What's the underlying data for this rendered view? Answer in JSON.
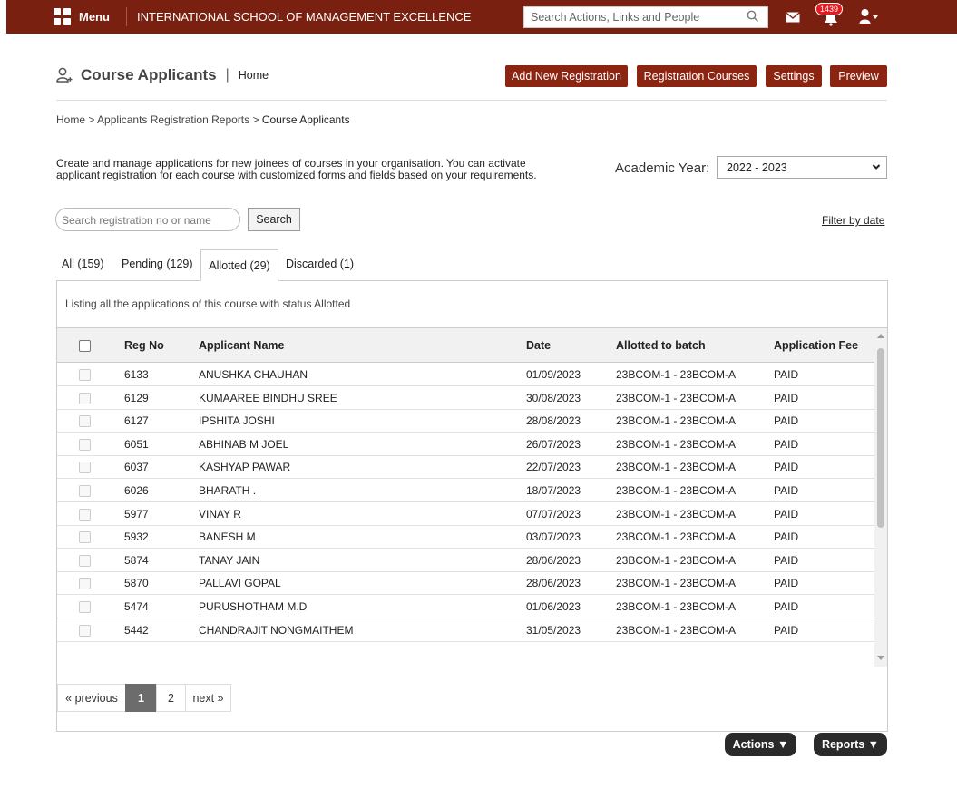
{
  "topbar": {
    "menu_label": "Menu",
    "school_name": "INTERNATIONAL SCHOOL OF MANAGEMENT EXCELLENCE",
    "search_placeholder": "Search Actions, Links and People",
    "notification_count": "1439",
    "brand_color": "#7a2010"
  },
  "header": {
    "title": "Course Applicants",
    "separator": "|",
    "subtitle": "Home",
    "buttons": {
      "add_new": "Add New Registration",
      "reg_courses": "Registration Courses",
      "settings": "Settings",
      "preview": "Preview"
    }
  },
  "breadcrumb": {
    "home": "Home",
    "sep": ">",
    "reports": "Applicants Registration Reports",
    "current": "Course Applicants"
  },
  "description": {
    "line1": "Create and manage applications for new joinees of courses in your organisation. You can activate",
    "line2": "applicant registration for each course with customized forms and fields based on your requirements."
  },
  "academic_year": {
    "label": "Academic Year:",
    "selected": "2022 - 2023"
  },
  "search": {
    "placeholder": "Search registration no or name",
    "button": "Search",
    "filter_link": "Filter by date"
  },
  "tabs": [
    {
      "label": "All (159)"
    },
    {
      "label": "Pending (129)"
    },
    {
      "label": "Allotted (29)"
    },
    {
      "label": "Discarded (1)"
    }
  ],
  "active_tab": "Allotted (29)",
  "listing_note": "Listing all the applications of this course with status Allotted",
  "table": {
    "columns": [
      "Reg No",
      "Applicant Name",
      "Date",
      "Allotted to batch",
      "Application Fee"
    ],
    "rows": [
      {
        "reg": "6133",
        "name": "ANUSHKA CHAUHAN",
        "date": "01/09/2023",
        "batch": "23BCOM-1 - 23BCOM-A",
        "fee": "PAID"
      },
      {
        "reg": "6129",
        "name": "KUMAAREE BINDHU SREE",
        "date": "30/08/2023",
        "batch": "23BCOM-1 - 23BCOM-A",
        "fee": "PAID"
      },
      {
        "reg": "6127",
        "name": "IPSHITA JOSHI",
        "date": "28/08/2023",
        "batch": "23BCOM-1 - 23BCOM-A",
        "fee": "PAID"
      },
      {
        "reg": "6051",
        "name": "ABHINAB M JOEL",
        "date": "26/07/2023",
        "batch": "23BCOM-1 - 23BCOM-A",
        "fee": "PAID"
      },
      {
        "reg": "6037",
        "name": "KASHYAP PAWAR",
        "date": "22/07/2023",
        "batch": "23BCOM-1 - 23BCOM-A",
        "fee": "PAID"
      },
      {
        "reg": "6026",
        "name": "BHARATH .",
        "date": "18/07/2023",
        "batch": "23BCOM-1 - 23BCOM-A",
        "fee": "PAID"
      },
      {
        "reg": "5977",
        "name": "VINAY R",
        "date": "07/07/2023",
        "batch": "23BCOM-1 - 23BCOM-A",
        "fee": "PAID"
      },
      {
        "reg": "5932",
        "name": "BANESH M",
        "date": "03/07/2023",
        "batch": "23BCOM-1 - 23BCOM-A",
        "fee": "PAID"
      },
      {
        "reg": "5874",
        "name": "TANAY JAIN",
        "date": "28/06/2023",
        "batch": "23BCOM-1 - 23BCOM-A",
        "fee": "PAID"
      },
      {
        "reg": "5870",
        "name": "PALLAVI GOPAL",
        "date": "28/06/2023",
        "batch": "23BCOM-1 - 23BCOM-A",
        "fee": "PAID"
      },
      {
        "reg": "5474",
        "name": "PURUSHOTHAM M.D",
        "date": "01/06/2023",
        "batch": "23BCOM-1 - 23BCOM-A",
        "fee": "PAID"
      },
      {
        "reg": "5442",
        "name": "CHANDRAJIT NONGMAITHEM",
        "date": "31/05/2023",
        "batch": "23BCOM-1 - 23BCOM-A",
        "fee": "PAID"
      }
    ]
  },
  "pagination": {
    "previous": "« previous",
    "pages": [
      "1",
      "2"
    ],
    "current": "1",
    "next": "next »"
  },
  "footer_buttons": {
    "actions": "Actions ▼",
    "reports": "Reports ▼"
  },
  "icons": {
    "menu": "grid-icon",
    "search": "search-icon",
    "mail": "mail-icon",
    "bell": "bell-icon",
    "user": "user-icon",
    "title": "user-add-icon"
  }
}
